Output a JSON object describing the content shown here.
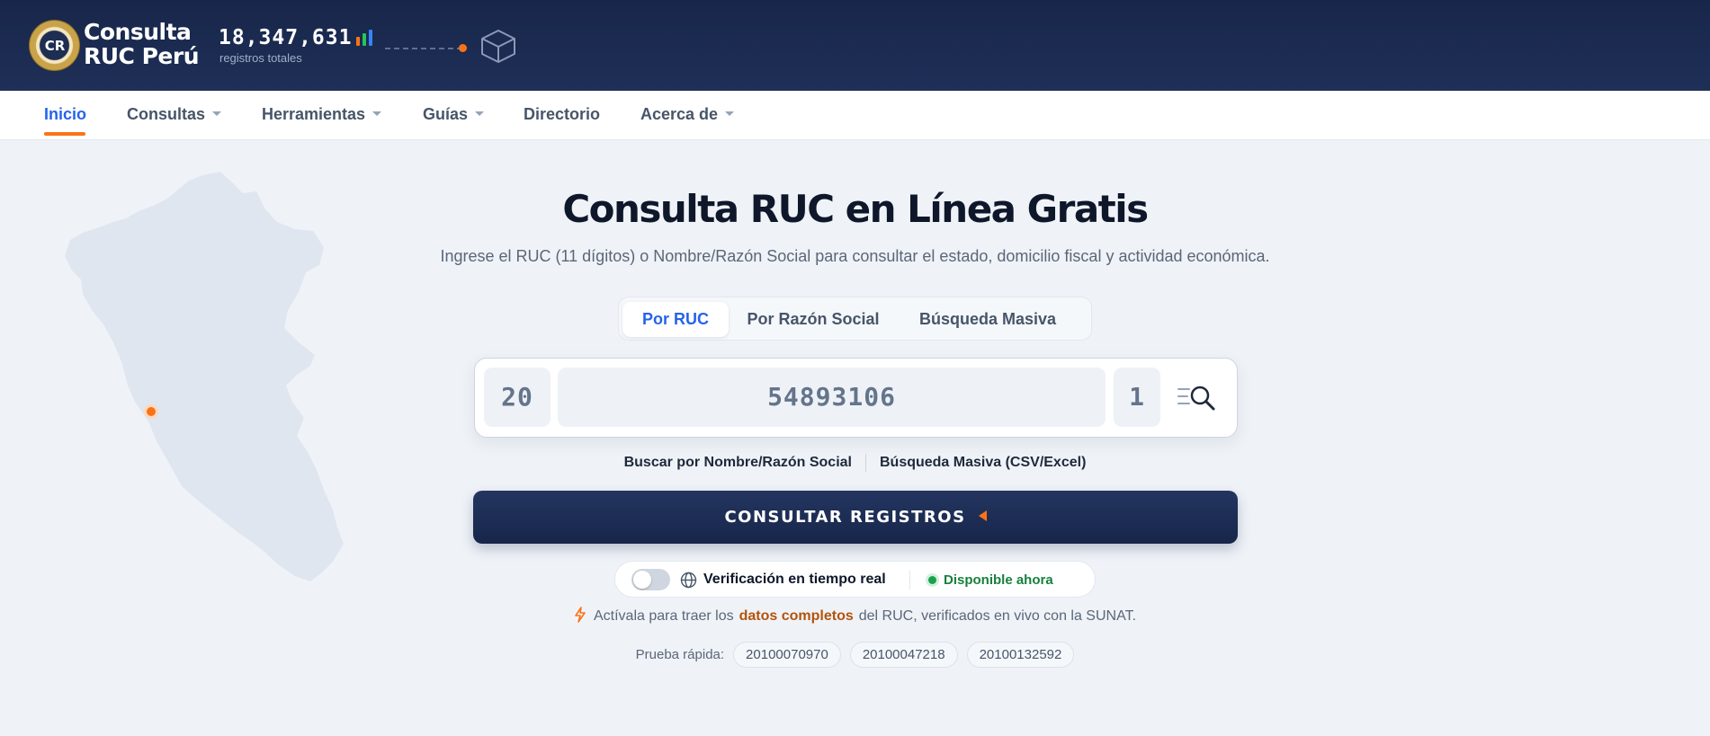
{
  "header": {
    "logo_mono": "CR",
    "logo_line1": "Consulta",
    "logo_line2": "RUC Perú",
    "count": "18,347,631",
    "count_label": "registros totales"
  },
  "nav": {
    "items": [
      {
        "label": "Inicio",
        "active": true
      },
      {
        "label": "Consultas",
        "dropdown": true
      },
      {
        "label": "Herramientas",
        "dropdown": true
      },
      {
        "label": "Guías",
        "dropdown": true
      },
      {
        "label": "Directorio",
        "dropdown": false
      },
      {
        "label": "Acerca de",
        "dropdown": true
      }
    ]
  },
  "main": {
    "title": "Consulta RUC en Línea Gratis",
    "subtitle": "Ingrese el RUC (11 dígitos) o Nombre/Razón Social para consultar el estado, domicilio fiscal y actividad económica.",
    "tabs": [
      {
        "label": "Por RUC",
        "active": true
      },
      {
        "label": "Por Razón Social"
      },
      {
        "label": "Búsqueda Masiva"
      }
    ],
    "ruc_prefix": "20",
    "ruc_body": "54893106",
    "ruc_check": "1",
    "link_name": "Buscar por Nombre/Razón Social",
    "link_bulk": "Búsqueda Masiva (CSV/Excel)",
    "cta": "CONSULTAR REGISTROS",
    "verify_label": "Verificación en tiempo real",
    "verify_toggle_on": false,
    "available": "Disponible ahora",
    "note_before": "Actívala para traer los",
    "note_strong": "datos completos",
    "note_after": "del RUC, verificados en vivo con la SUNAT.",
    "quick_label": "Prueba rápida:",
    "quick_chips": [
      "20100070970",
      "20100047218",
      "20100132592"
    ]
  },
  "colors": {
    "header_bg": "#18264a",
    "accent_blue": "#2563eb",
    "accent_orange": "#f97316",
    "status_green": "#16a34a"
  },
  "icons": [
    "bar-chart-icon",
    "cube-icon",
    "search-list-icon",
    "globe-icon",
    "bolt-icon",
    "caret-down-icon"
  ]
}
